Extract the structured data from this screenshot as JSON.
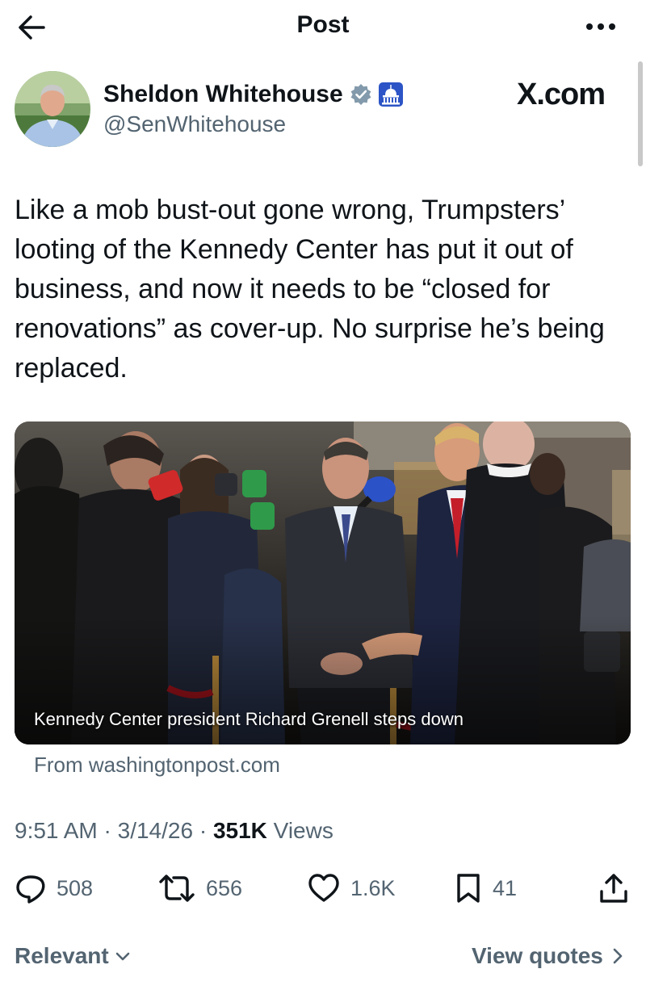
{
  "header": {
    "title": "Post"
  },
  "author": {
    "name": "Sheldon Whitehouse",
    "handle": "@SenWhitehouse",
    "verified_color": "#829aab"
  },
  "brand": "X.com",
  "post": {
    "text": "Like a mob bust-out gone wrong, Trumpsters’ looting of the Kennedy Center has put it out of business, and now it needs to be “closed for renovations” as cover-up. No surprise he’s being replaced."
  },
  "card": {
    "caption": "Kennedy Center president Richard Grenell steps down",
    "source": "From washingtonpost.com"
  },
  "meta": {
    "time": "9:51 AM",
    "date": "3/14/26",
    "views_count": "351K",
    "views_label": "Views"
  },
  "actions": {
    "replies": "508",
    "reposts": "656",
    "likes": "1.6K",
    "bookmarks": "41"
  },
  "footer": {
    "sort_label": "Relevant",
    "view_quotes_label": "View quotes"
  },
  "colors": {
    "text": "#0f1419",
    "secondary": "#536471"
  }
}
